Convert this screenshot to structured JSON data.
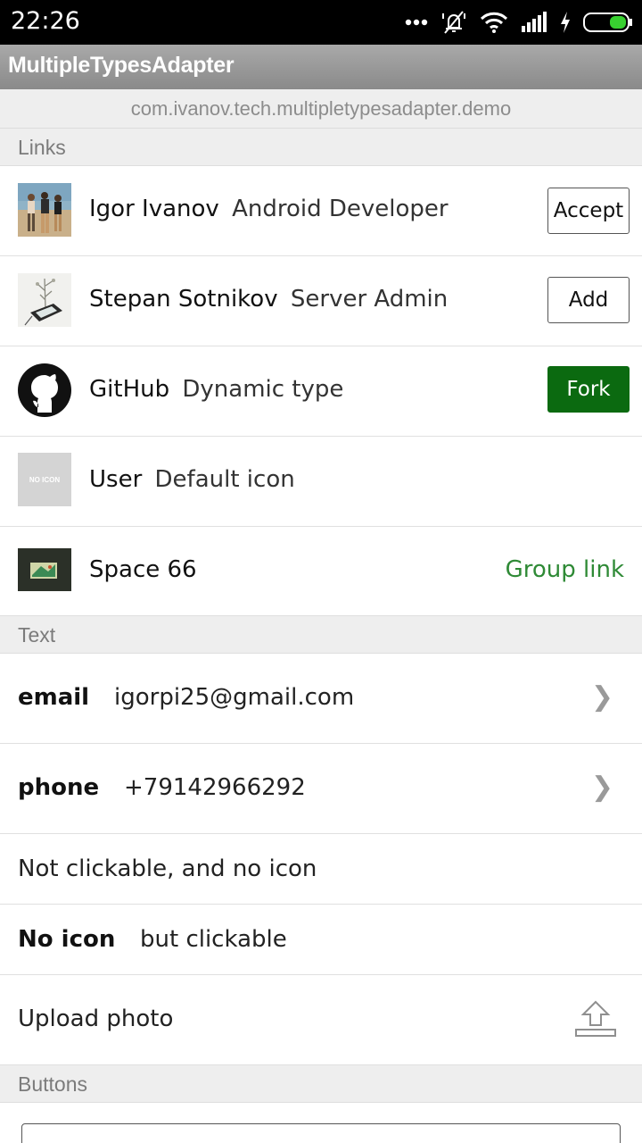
{
  "status_bar": {
    "time": "22:26",
    "icons": [
      "more-dots-icon",
      "silent-bell-icon",
      "wifi-icon",
      "signal-icon",
      "charging-icon",
      "battery-icon"
    ]
  },
  "app": {
    "title": "MultipleTypesAdapter",
    "package": "com.ivanov.tech.multipletypesadapter.demo"
  },
  "sections": {
    "links": "Links",
    "text": "Text",
    "buttons": "Buttons"
  },
  "links": [
    {
      "name": "Igor Ivanov",
      "desc": "Android Developer",
      "action": "Accept",
      "icon": "photo-people-icon"
    },
    {
      "name": "Stepan Sotnikov",
      "desc": "Server Admin",
      "action": "Add",
      "icon": "photo-phone-icon"
    },
    {
      "name": "GitHub",
      "desc": "Dynamic type",
      "action": "Fork",
      "icon": "github-icon"
    },
    {
      "name": "User",
      "desc": "Default icon",
      "icon": "no-icon-placeholder",
      "icon_text": "NO ICON"
    },
    {
      "name": "Space 66",
      "desc": "",
      "link": "Group link",
      "icon": "photo-space-icon"
    }
  ],
  "text_rows": {
    "email_label": "email",
    "email_value": "igorpi25@gmail.com",
    "phone_label": "phone",
    "phone_value": "+79142966292",
    "plain": "Not clickable, and no icon",
    "noicon_label": "No icon",
    "noicon_value": "but clickable",
    "upload": "Upload photo",
    "chevron": "❯"
  },
  "colors": {
    "fork_button": "#0b6a10",
    "group_link": "#2f8a36",
    "battery": "#38d130"
  }
}
